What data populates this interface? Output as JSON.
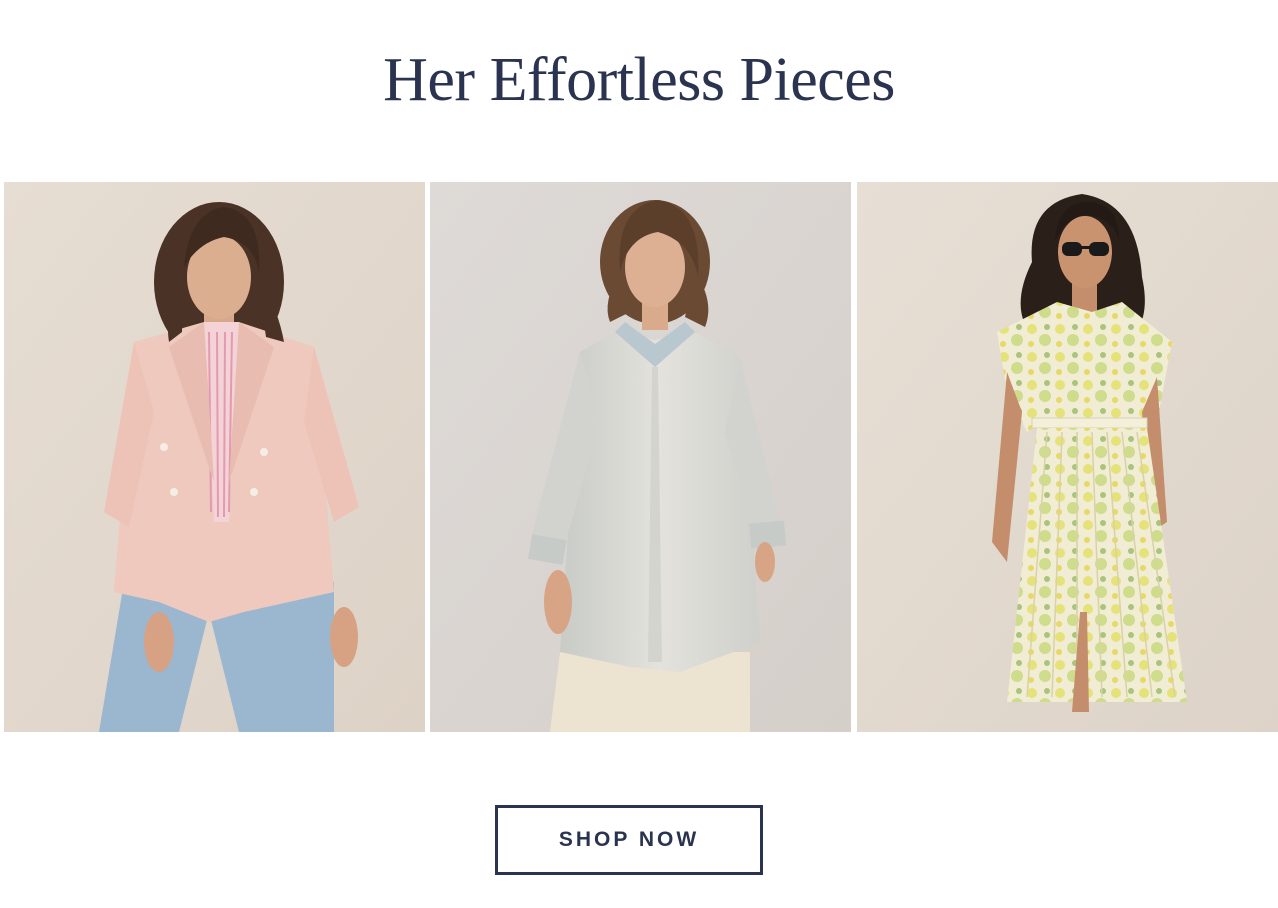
{
  "section": {
    "title": "Her Effortless Pieces"
  },
  "products": [
    {
      "image": "model-in-pink-double-breasted-blazer-and-light-wash-jeans"
    },
    {
      "image": "model-in-pale-blue-satin-button-up-shirt-and-cream-trousers"
    },
    {
      "image": "model-in-yellow-floral-pleated-belted-shirt-dress"
    }
  ],
  "cta": {
    "label": "SHOP NOW"
  },
  "colors": {
    "heading": "#2a3350",
    "button_border": "#2a3350",
    "background": "#ffffff"
  }
}
